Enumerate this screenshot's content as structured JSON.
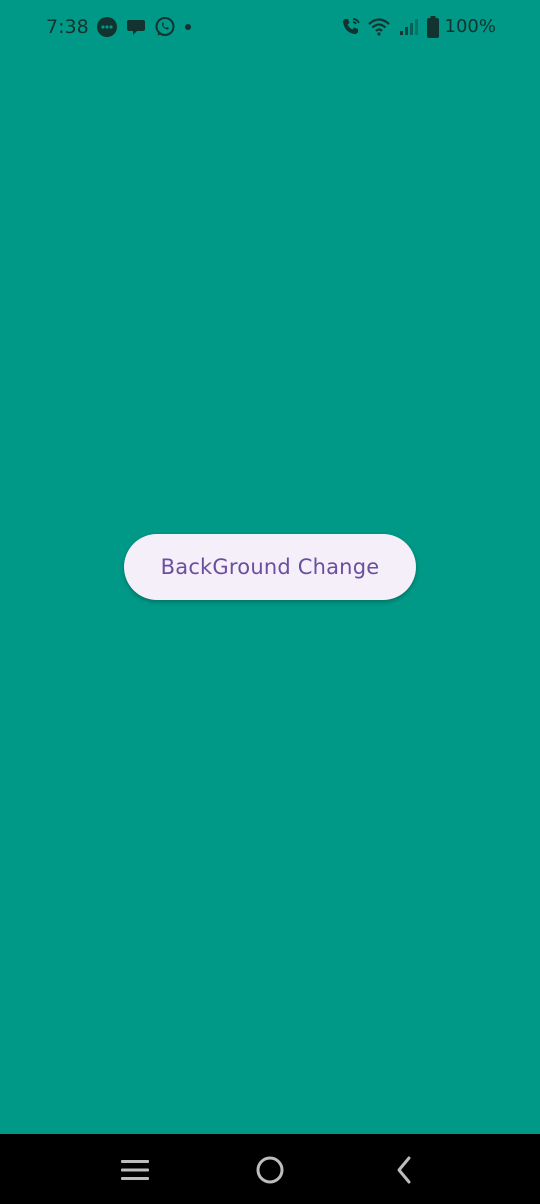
{
  "status_bar": {
    "time": "7:38",
    "battery_text": "100%",
    "notification_icons": [
      "messenger-icon",
      "chat-bubble-icon",
      "whatsapp-icon",
      "more-dot-icon"
    ],
    "system_icons": [
      "wifi-calling-icon",
      "wifi-icon",
      "signal-icon",
      "battery-icon"
    ]
  },
  "main": {
    "background_color": "#009886",
    "button_label": "BackGround Change"
  },
  "nav_bar": {
    "items": [
      "recents-icon",
      "home-icon",
      "back-icon"
    ]
  }
}
